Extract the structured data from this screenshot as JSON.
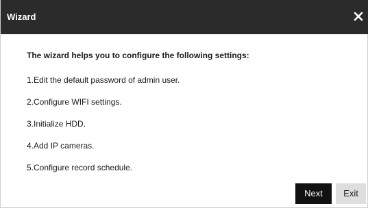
{
  "window": {
    "title": "Wizard",
    "close_icon": "close-icon"
  },
  "content": {
    "heading": "The wizard helps you to configure the following settings:",
    "steps": [
      "1.Edit the default password of admin user.",
      "2.Configure WIFI settings.",
      "3.Initialize HDD.",
      "4.Add IP cameras.",
      "5.Configure record schedule."
    ]
  },
  "buttons": {
    "next_label": "Next",
    "exit_label": "Exit"
  },
  "colors": {
    "titlebar": "#2b2b2b",
    "primary_button": "#111111",
    "secondary_button": "#dedede"
  }
}
